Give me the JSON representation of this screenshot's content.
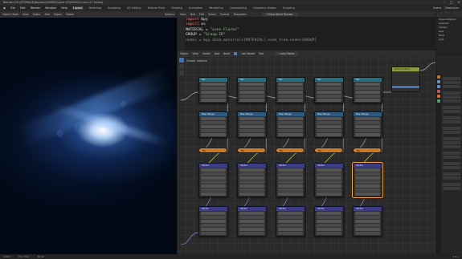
{
  "window": {
    "title": "Blender [D:\\\\STORAGE\\\\Assets\\\\LENSES\\\\Lens 07\\\\2022\\\\1 Lens 07 Series]",
    "controls": [
      "–",
      "□",
      "×"
    ]
  },
  "menu": [
    "File",
    "Edit",
    "Render",
    "Window",
    "Help"
  ],
  "workspaces": {
    "tabs": [
      "Layout",
      "Modeling",
      "Sculpting",
      "UV Editing",
      "Texture Paint",
      "Shading",
      "Animation",
      "Rendering",
      "Compositing",
      "Geometry Nodes",
      "Scripting"
    ],
    "active": "Layout"
  },
  "scene": {
    "name": "Scene",
    "view_layer": "ViewLayer"
  },
  "viewport": {
    "header_items": [
      "Object Mode",
      "View",
      "Select",
      "Add",
      "Object"
    ],
    "orientation": "Global",
    "options": "Options"
  },
  "text_editor": {
    "header_items": [
      "View",
      "Text",
      "Edit",
      "Select",
      "Format",
      "Templates"
    ],
    "file": "+Glow Batch Render",
    "lines": [
      {
        "n": "1",
        "tokens": [
          {
            "k": "kw",
            "t": "import"
          },
          {
            "k": "plain",
            "t": " bpy"
          }
        ]
      },
      {
        "n": "2",
        "tokens": [
          {
            "k": "kw",
            "t": "import"
          },
          {
            "k": "plain",
            "t": " os"
          }
        ]
      },
      {
        "n": "3",
        "tokens": [
          {
            "k": "plain",
            "t": ""
          }
        ]
      },
      {
        "n": "4",
        "tokens": [
          {
            "k": "plain",
            "t": "MATERIAL = "
          },
          {
            "k": "str",
            "t": "\"Lens Flares\""
          }
        ]
      },
      {
        "n": "5",
        "tokens": [
          {
            "k": "plain",
            "t": "GROUP = "
          },
          {
            "k": "str",
            "t": "\"Group-ID\""
          }
        ]
      },
      {
        "n": "6",
        "tokens": [
          {
            "k": "dim",
            "t": "nodes = bpy.data.materials[MATERIAL].node_tree.nodes[GROUP]"
          }
        ]
      }
    ]
  },
  "node_editor": {
    "header_items": [
      "Object",
      "View",
      "Select",
      "Add",
      "Node"
    ],
    "use_nodes": "Use Nodes",
    "slot": "Slot",
    "material": "Lens Flares",
    "breadcrumb": "Shader Inactive",
    "columns": [
      {
        "tex": "Tex",
        "conv": "Map Range",
        "mix": "Mix",
        "vec": "Vector",
        "vec2": "Vector"
      },
      {
        "tex": "Tex",
        "conv": "Map Range",
        "mix": "Mix",
        "vec": "Vector",
        "vec2": "Vector"
      },
      {
        "tex": "Tex",
        "conv": "Map Range",
        "mix": "Mix",
        "vec": "Vector",
        "vec2": "Vector"
      },
      {
        "tex": "Tex",
        "conv": "Map Range",
        "mix": "Mix",
        "vec": "Vector",
        "vec2": "Vector"
      },
      {
        "tex": "Tex",
        "conv": "Map Range",
        "mix": "Mix",
        "vec": "Vector",
        "vec2": "Vector"
      }
    ],
    "output_node": "Group Output"
  },
  "outliner": {
    "rows": [
      "Scene Collection",
      "Collection",
      "Camera",
      "Lens",
      "Plane",
      "Light"
    ]
  },
  "status": {
    "left": [
      "Select",
      "Pan View",
      "Node"
    ],
    "right": "3.4.1"
  },
  "colors": {
    "accent": "#4772b3",
    "texture_header": "#236d7f",
    "converter_header": "#2b5a82",
    "vector_header": "#3c3c83",
    "mix_node": "#c97a2b",
    "output_header": "#8e9a3d",
    "wire": "#8a84c9"
  }
}
